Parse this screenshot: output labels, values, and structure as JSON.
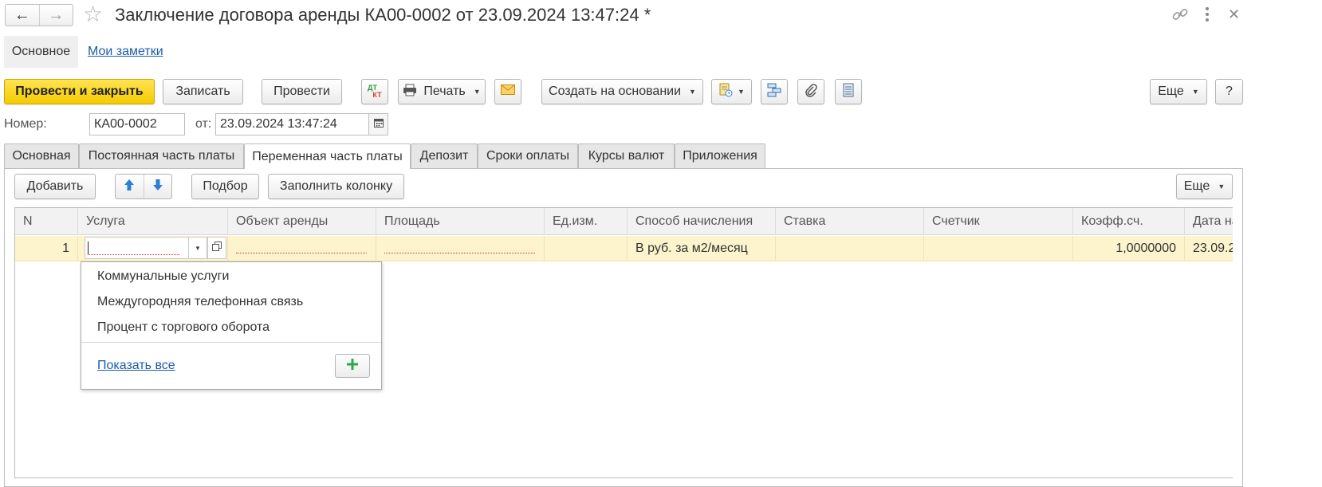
{
  "window": {
    "title": "Заключение договора аренды КА00-0002 от 23.09.2024 13:47:24 *"
  },
  "nav": {
    "main_label": "Основное",
    "notes_link": "Мои заметки"
  },
  "toolbar": {
    "post_close": "Провести и закрыть",
    "save": "Записать",
    "post": "Провести",
    "dtkt_top": "ДТ",
    "dtkt_bottom": "КТ",
    "print": "Печать",
    "create_based": "Создать на основании",
    "more": "Еще",
    "help": "?"
  },
  "header_fields": {
    "number_label": "Номер:",
    "number_value": "КА00-0002",
    "date_label": "от:",
    "date_value": "23.09.2024 13:47:24"
  },
  "tabs": [
    {
      "label": "Основная"
    },
    {
      "label": "Постоянная часть платы"
    },
    {
      "label": "Переменная часть платы"
    },
    {
      "label": "Депозит"
    },
    {
      "label": "Сроки оплаты"
    },
    {
      "label": "Курсы валют"
    },
    {
      "label": "Приложения"
    }
  ],
  "active_tab_index": 2,
  "table_toolbar": {
    "add": "Добавить",
    "pick": "Подбор",
    "fill_column": "Заполнить колонку",
    "more": "Еще"
  },
  "table": {
    "columns": [
      "N",
      "Услуга",
      "Объект аренды",
      "Площадь",
      "Ед.изм.",
      "Способ начисления",
      "Ставка",
      "Счетчик",
      "Коэфф.сч.",
      "Дата на"
    ],
    "rows": [
      {
        "n": "1",
        "service": "",
        "object": "",
        "area": "",
        "unit": "",
        "method": "В руб. за м2/месяц",
        "rate": "",
        "counter": "",
        "coef": "1,0000000",
        "date": "23.09.2"
      }
    ]
  },
  "dropdown": {
    "items": [
      "Коммунальные услуги",
      "Междугородняя телефонная связь",
      "Процент с торгового оборота"
    ],
    "show_all": "Показать все"
  },
  "colors": {
    "primary_button": "#f4cc00",
    "row_highlight": "#fdf3cc",
    "link": "#1a5ca8",
    "required_underline": "#d43a2a",
    "arrow_blue": "#2a7fd4",
    "add_green": "#2aa84a"
  }
}
